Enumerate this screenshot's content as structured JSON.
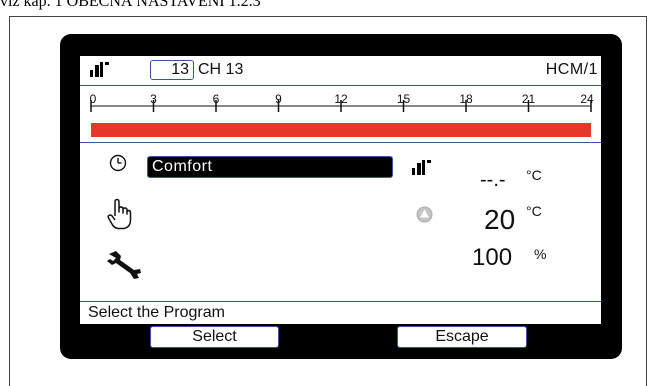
{
  "document": {
    "caption": "viz kap. 1 OBECNÁ NASTAVENÍ 1.2.3"
  },
  "header": {
    "channel_number": "13",
    "channel_name": "CH 13",
    "module": "HCM/1"
  },
  "timeline": {
    "tick_labels": [
      "0",
      "3",
      "6",
      "9",
      "12",
      "15",
      "18",
      "21",
      "24"
    ],
    "bar_color": "#e8362a",
    "active_from_hour": 0,
    "active_to_hour": 24
  },
  "program": {
    "value": "Comfort"
  },
  "readings": {
    "measured_value": "--.-",
    "measured_unit": "°C",
    "setpoint_value": "20",
    "setpoint_unit": "°C",
    "output_value": "100",
    "output_unit": "%"
  },
  "status": {
    "message": "Select the Program"
  },
  "softkeys": {
    "select_label": "Select",
    "escape_label": "Escape"
  },
  "colors": {
    "accent_line": "#3a55a0",
    "device_bezel": "#000000",
    "pump_icon": "#b8b8b8"
  },
  "icons": {
    "heating_unit": "radiator-icon",
    "clock": "clock-icon",
    "manual": "hand-icon",
    "service": "wrench-icon",
    "pump": "pump-icon"
  }
}
